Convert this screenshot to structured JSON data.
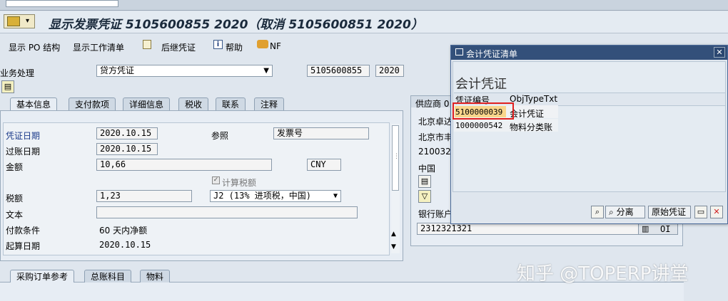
{
  "title_bar": {
    "title": "显示发票凭证 5105600855 2020（取消 5105600851 2020）"
  },
  "toolbar": {
    "items": [
      "显示 PO 结构",
      "显示工作清单",
      "后继凭证",
      "帮助",
      "NF"
    ]
  },
  "header": {
    "transaction_label": "业务处理",
    "transaction_value": "贷方凭证",
    "doc_number": "5105600855",
    "year": "2020"
  },
  "tabs": [
    "基本信息",
    "支付款项",
    "详细信息",
    "税收",
    "联系",
    "注释"
  ],
  "basic": {
    "doc_date_label": "凭证日期",
    "doc_date": "2020.10.15",
    "reference_label": "参照",
    "reference": "发票号",
    "posting_date_label": "过账日期",
    "posting_date": "2020.10.15",
    "amount_label": "金额",
    "amount": "10,66",
    "currency": "CNY",
    "calc_tax_label": "计算税额",
    "tax_label": "税额",
    "tax": "1,23",
    "tax_code": "J2 (13% 进项税，中国)",
    "text_label": "文本",
    "text": "",
    "payment_terms_label": "付款条件",
    "payment_terms": "60 天内净额",
    "baseline_label": "起算日期",
    "baseline": "2020.10.15"
  },
  "vendor": {
    "title": "供应商 0",
    "line1": "北京卓达",
    "line2": "北京市丰",
    "line3": "210032",
    "country": "中国",
    "bank_label": "银行账户",
    "bank_value": "2312321321",
    "oi_label": "OI"
  },
  "bottom_tabs": [
    "采购订单参考",
    "总账科目",
    "物料"
  ],
  "popup": {
    "title": "会计凭证清单",
    "heading": "会计凭证",
    "columns": [
      "凭证编号",
      "ObjTypeTxt"
    ],
    "rows": [
      {
        "number": "5100000039",
        "type": "会计凭证"
      },
      {
        "number": "1000000542",
        "type": "物料分类账"
      }
    ],
    "btn_split": "分离",
    "btn_original": "原始凭证"
  },
  "watermark": "知乎 @TOPERP讲堂",
  "colors": {
    "highlight": "#f9d68c",
    "red_box": "#e02020",
    "popup_header": "#33507a"
  }
}
